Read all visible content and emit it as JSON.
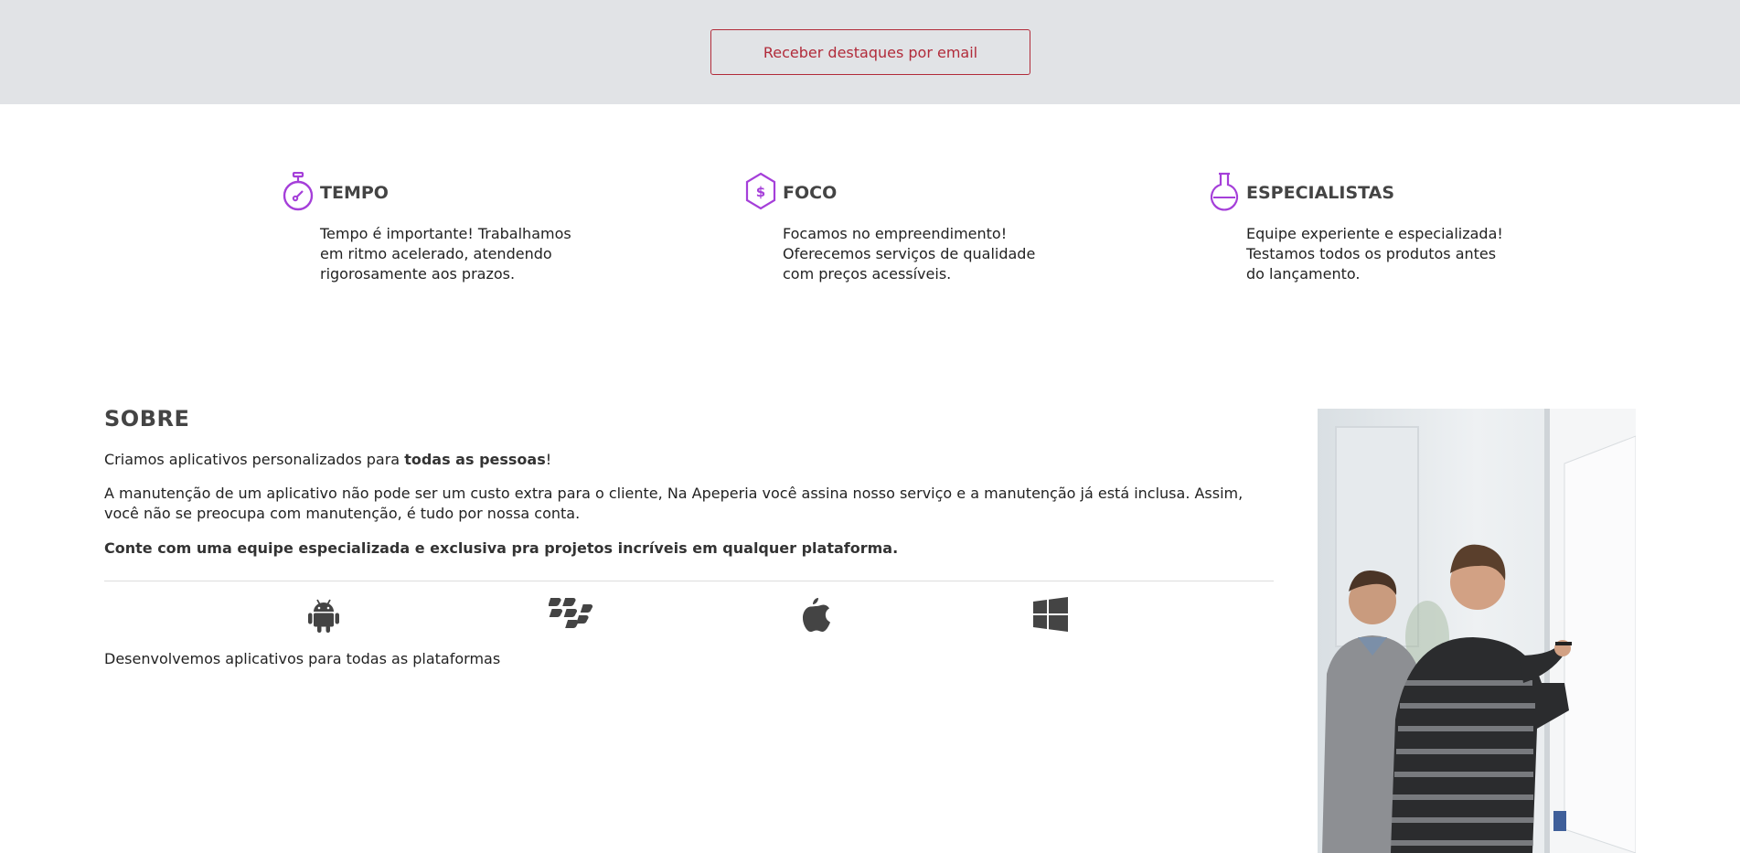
{
  "banner": {
    "email_button_label": "Receber destaques por email"
  },
  "features": [
    {
      "icon": "stopwatch-icon",
      "title": "TEMPO",
      "lines": [
        "Tempo é importante! Trabalhamos",
        "em ritmo acelerado, atendendo",
        "rigorosamente aos prazos."
      ]
    },
    {
      "icon": "dollar-hexagon-icon",
      "title": "FOCO",
      "lines": [
        "Focamos no empreendimento!",
        "Oferecemos serviços de qualidade",
        "com preços acessíveis."
      ]
    },
    {
      "icon": "flask-icon",
      "title": "ESPECIALISTAS",
      "lines": [
        "Equipe experiente e especializada!",
        "Testamos todos os produtos antes",
        "do lançamento."
      ]
    }
  ],
  "about": {
    "title": "SOBRE",
    "intro_prefix": "Criamos aplicativos personalizados para ",
    "intro_bold": "todas as pessoas",
    "intro_suffix": "!",
    "paragraph": "A manutenção de um aplicativo não pode ser um custo extra para o cliente, Na Apeperia você assina nosso serviço e a manutenção já está inclusa. Assim, você não se preocupa com manutenção, é tudo por nossa conta.",
    "highlight": "Conte com uma equipe especializada e exclusiva pra projetos incríveis em qualquer plataforma.",
    "platforms": [
      "android-icon",
      "blackberry-icon",
      "apple-icon",
      "windows-icon"
    ],
    "platforms_caption": "Desenvolvemos aplicativos para todas as plataformas"
  },
  "colors": {
    "accent_purple": "#a53fd9",
    "button_red": "#b12b3a",
    "banner_bg": "#e1e3e6",
    "icon_gray": "#444444"
  }
}
